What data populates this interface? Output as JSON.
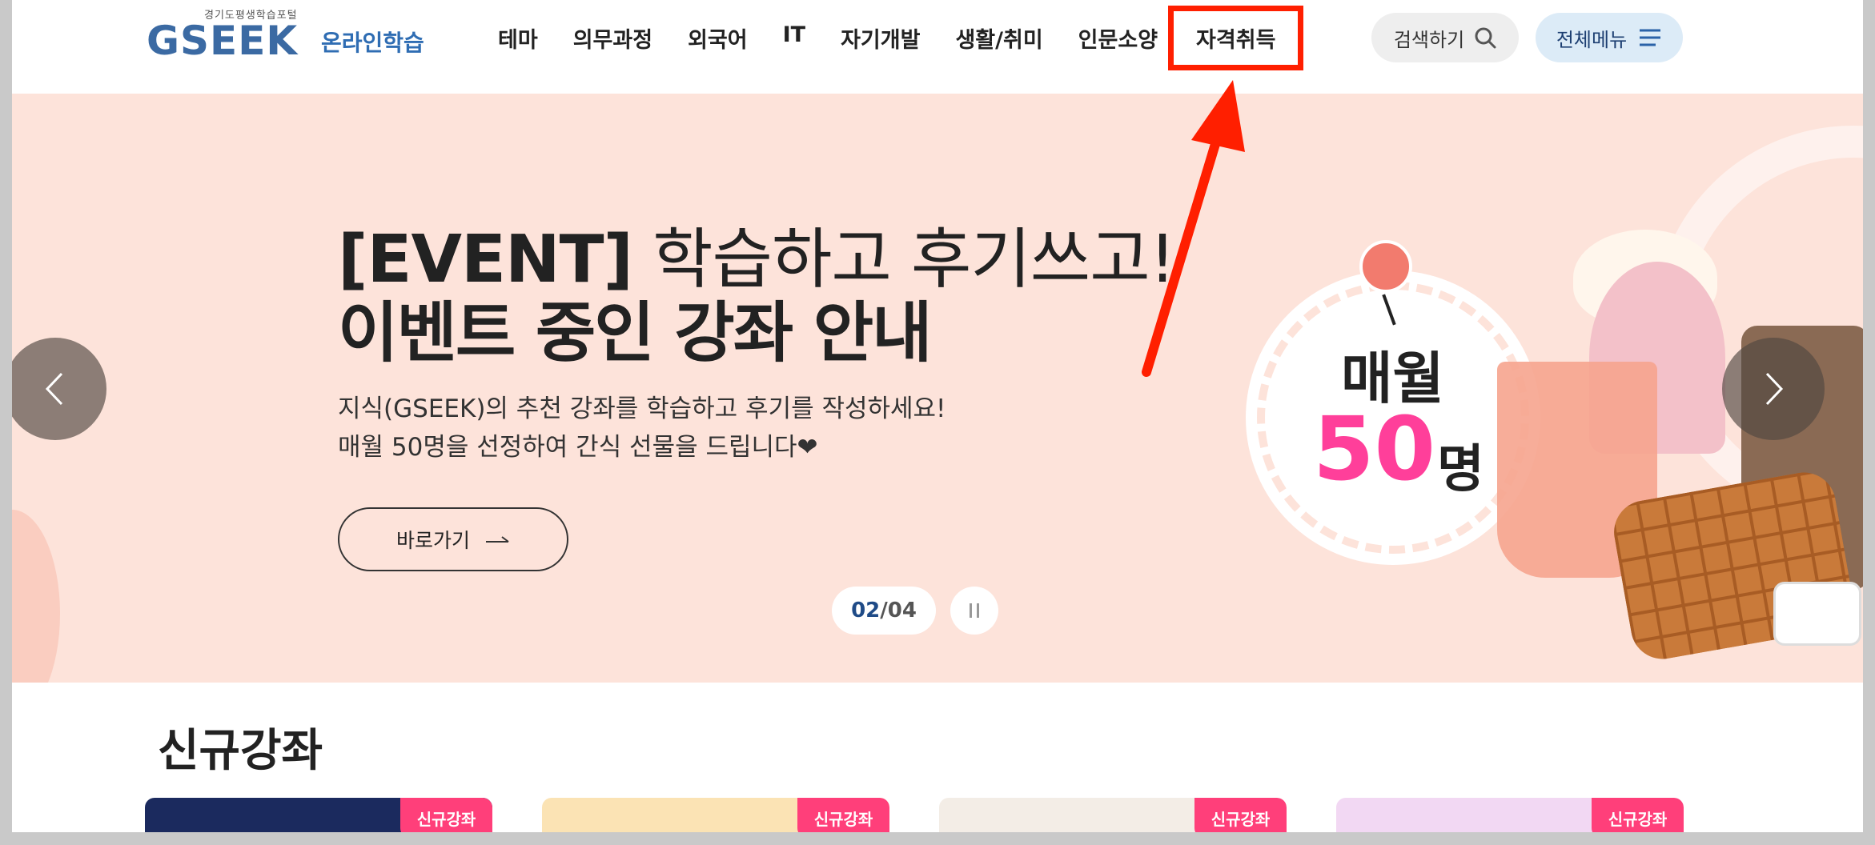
{
  "logo": {
    "tagline": "경기도평생학습포털",
    "name": "GSEEK",
    "sub": "온라인학습"
  },
  "nav": {
    "items": [
      "테마",
      "의무과정",
      "외국어",
      "IT",
      "자기개발",
      "생활/취미",
      "인문소양",
      "자격취득"
    ]
  },
  "header": {
    "search_label": "검색하기",
    "menu_label": "전체메뉴"
  },
  "hero": {
    "title_event": "[EVENT]",
    "title_rest": " 학습하고 후기쓰고!",
    "title_line2": "이벤트 중인 강좌 안내",
    "desc_line1": "지식(GSEEK)의 추천 강좌를 학습하고 후기를 작성하세요!",
    "desc_line2": "매월 50명을 선정하여 간식 선물을 드립니다❤",
    "button_label": "바로가기",
    "pager_current": "02",
    "pager_sep": "/",
    "pager_total": "04",
    "promo_month": "매월",
    "promo_number": "50",
    "promo_unit": "명"
  },
  "new_courses": {
    "title": "신규강좌",
    "badge": "신규강좌",
    "cards": [
      {
        "badge": "신규강좌",
        "color": "#1b2a5e"
      },
      {
        "badge": "신규강좌",
        "color": "#fbe3b4"
      },
      {
        "badge": "신규강좌",
        "color": "#f3ede6"
      },
      {
        "badge": "신규강좌",
        "color": "#f2d8f3"
      }
    ]
  },
  "colors": {
    "hero_bg": "#fde3da",
    "accent": "#ff1f00",
    "badge": "#ff3f7a",
    "brand": "#1f4b87"
  },
  "icons": {
    "search": "search-icon",
    "menu": "hamburger-icon",
    "prev": "chevron-left-icon",
    "next": "chevron-right-icon",
    "pause": "pause-icon",
    "arrow": "arrow-right-icon"
  }
}
